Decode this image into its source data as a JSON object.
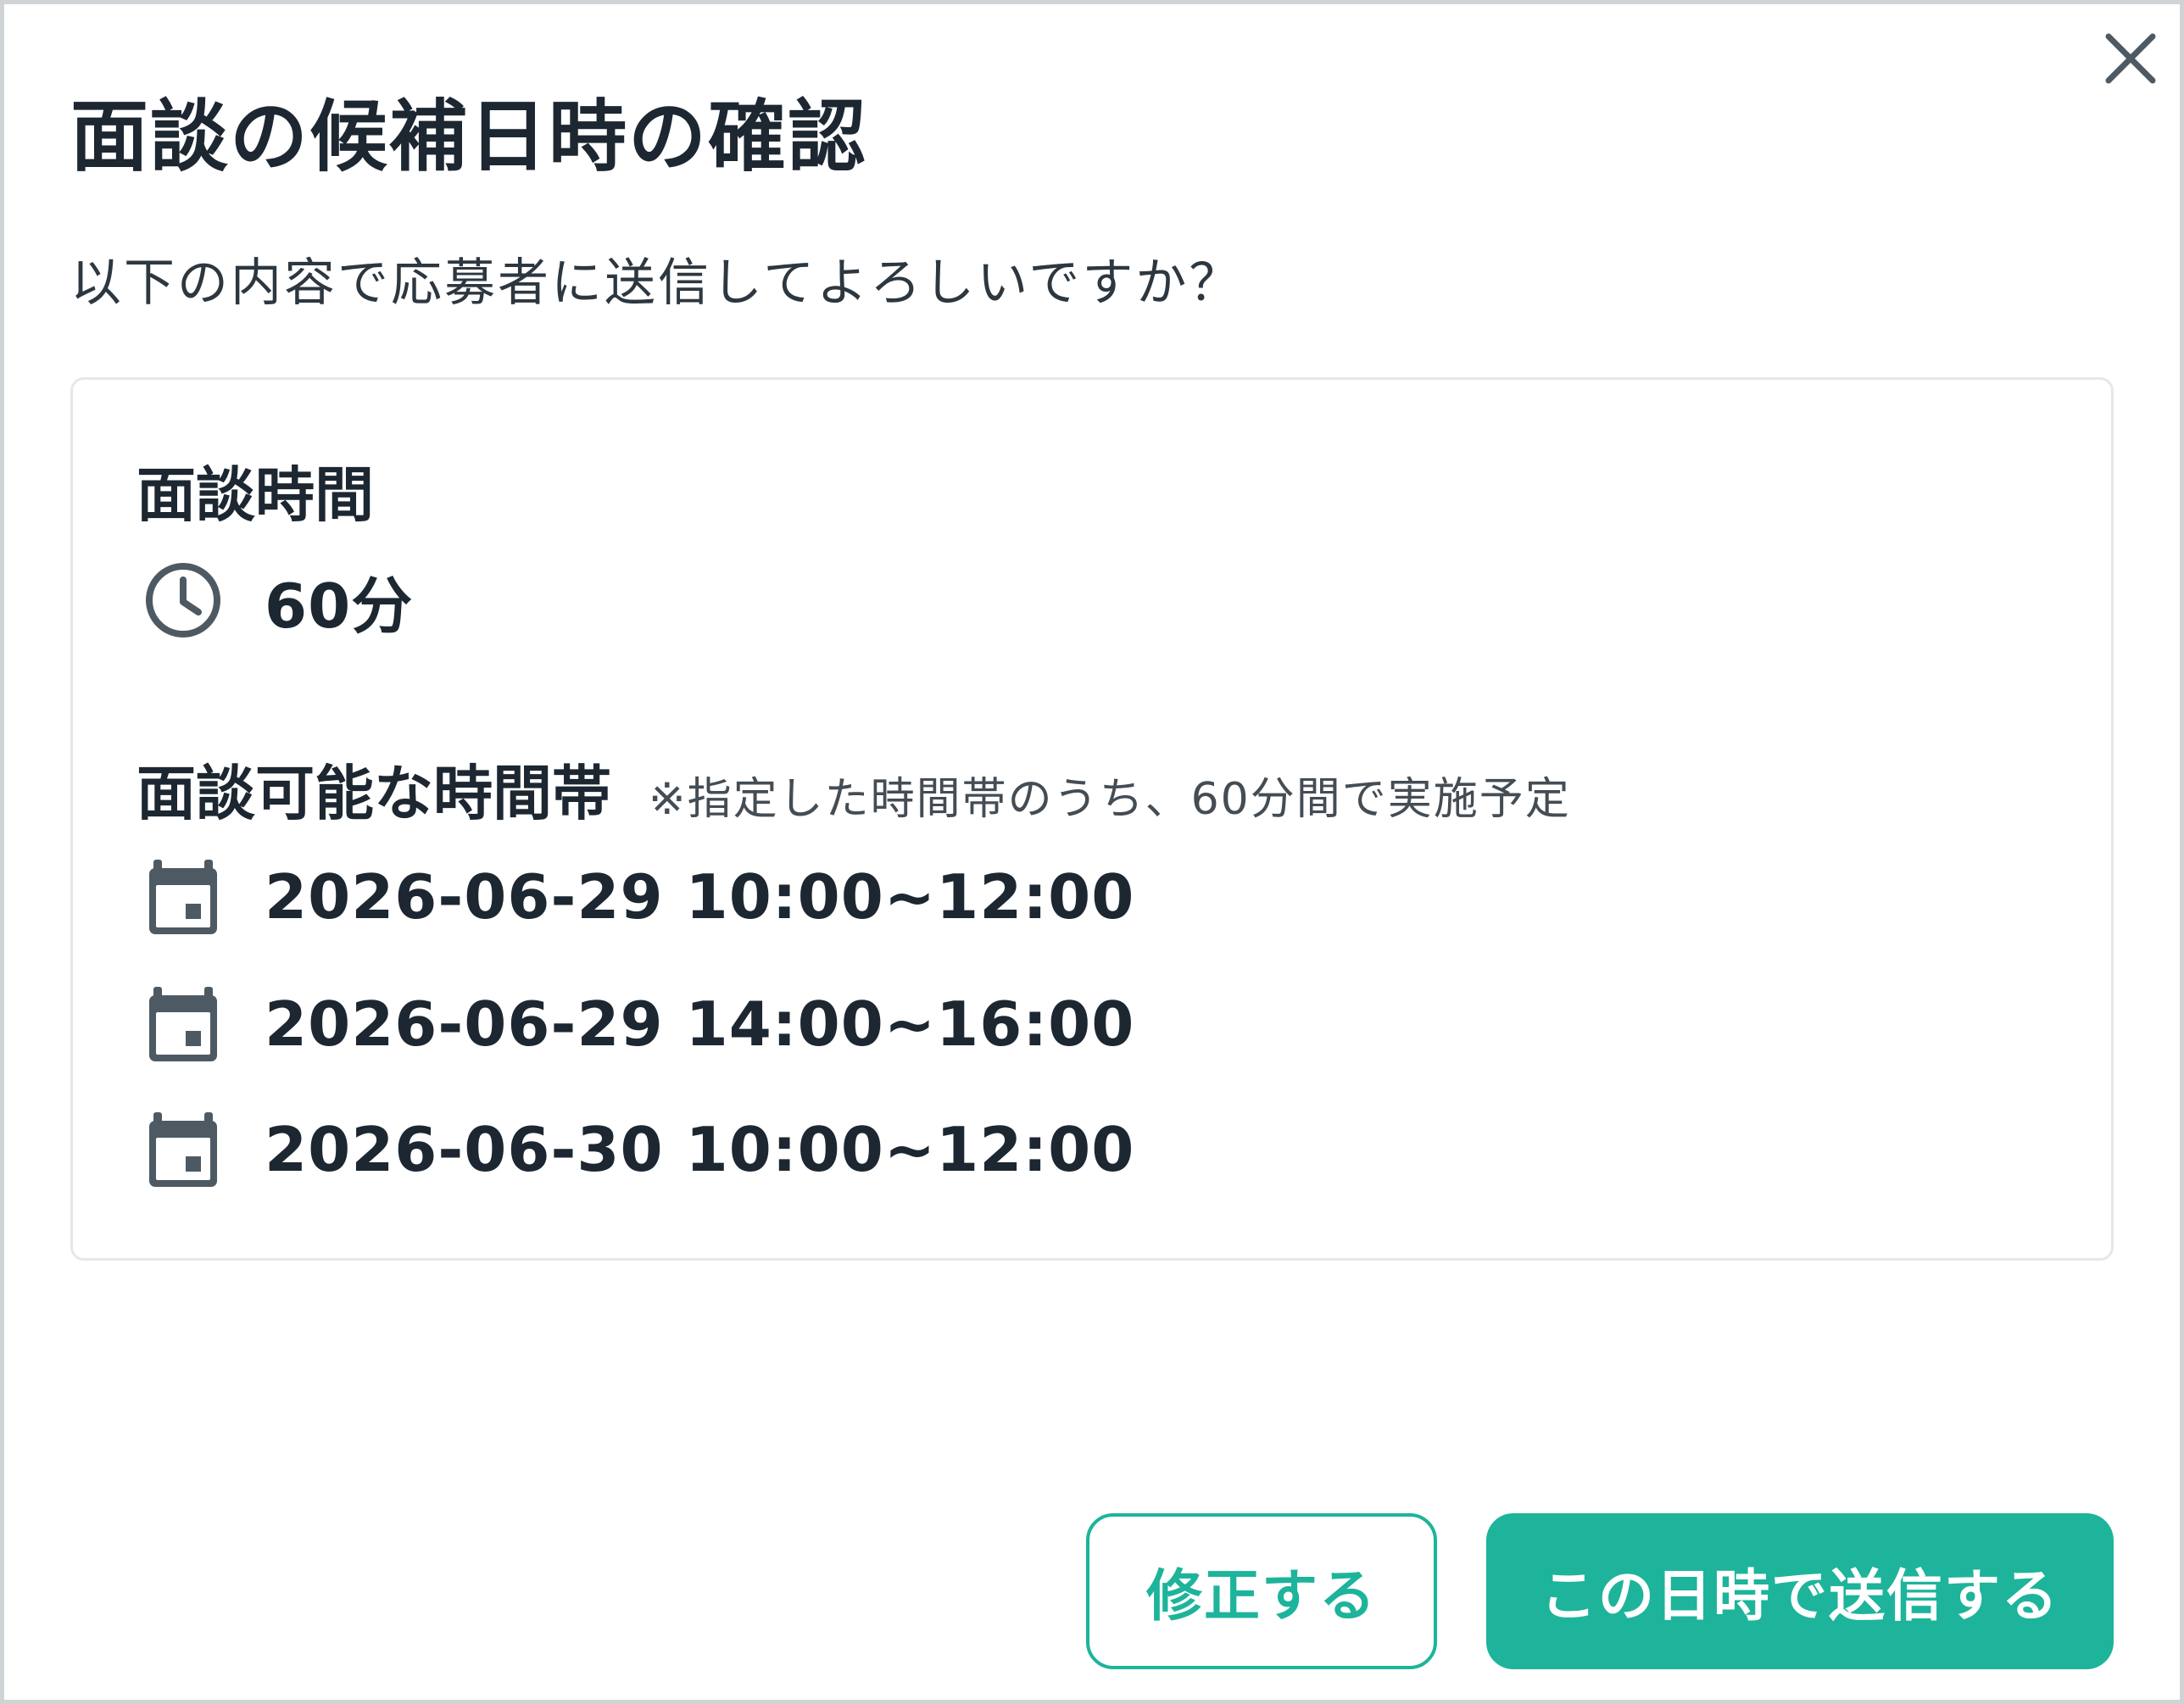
{
  "dialog": {
    "title": "面談の候補日時の確認",
    "subtitle": "以下の内容で応募者に送信してよろしいですか？",
    "close_icon": "close-icon"
  },
  "duration": {
    "heading": "面談時間",
    "value": "60分",
    "icon": "clock-icon"
  },
  "slots": {
    "heading": "面談可能な時間帯",
    "note": "※指定した時間帯のうち、60分間で実施予定",
    "icon": "calendar-icon",
    "items": [
      "2026-06-29 10:00~12:00",
      "2026-06-29 14:00~16:00",
      "2026-06-30 10:00~12:00"
    ]
  },
  "buttons": {
    "edit_label": "修正する",
    "send_label": "この日時で送信する"
  },
  "colors": {
    "accent": "#1db49b",
    "text": "#1d2731",
    "icon": "#4e5a63",
    "border": "#e5e8ea"
  }
}
